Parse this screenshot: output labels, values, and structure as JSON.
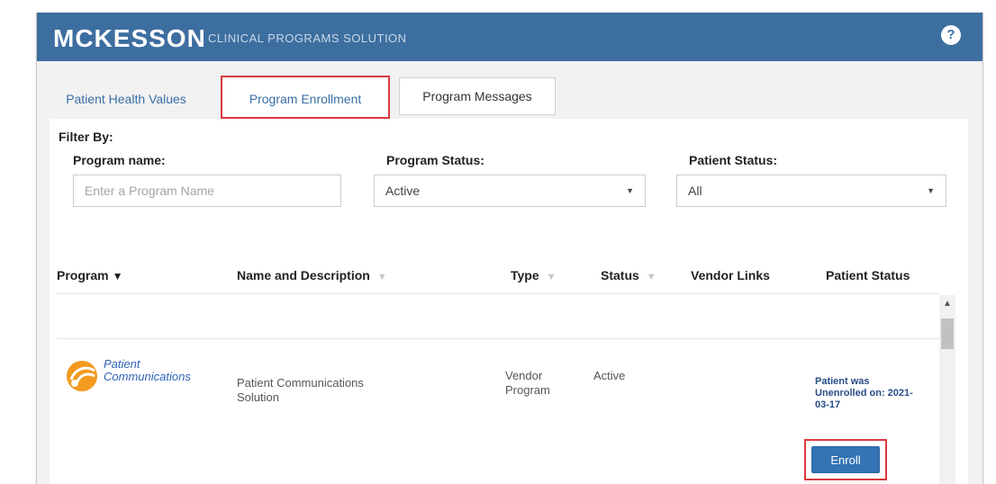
{
  "header": {
    "logo": "MCKESSON",
    "subtitle": "CLINICAL PROGRAMS SOLUTION",
    "help_icon": "?"
  },
  "tabs": [
    {
      "label": "Patient Health Values"
    },
    {
      "label": "Program Enrollment"
    },
    {
      "label": "Program Messages"
    }
  ],
  "filters": {
    "title": "Filter By:",
    "program_name_label": "Program name:",
    "program_name_placeholder": "Enter a Program Name",
    "program_status_label": "Program Status:",
    "program_status_value": "Active",
    "patient_status_label": "Patient Status:",
    "patient_status_value": "All"
  },
  "table": {
    "columns": [
      "Program",
      "Name and Description",
      "Type",
      "Status",
      "Vendor Links",
      "Patient Status"
    ],
    "rows": [
      {
        "logo_text_line1": "Patient",
        "logo_text_line2": "Communications",
        "name_line1": "Patient Communications",
        "name_line2": "Solution",
        "type_line1": "Vendor",
        "type_line2": "Program",
        "status": "Active",
        "vendor_links": "",
        "patient_status": "Patient was Unenrolled on: 2021-03-17",
        "action": "Enroll"
      }
    ]
  },
  "colors": {
    "header": "#3d6ea0",
    "link": "#3a6ea5",
    "highlight": "#d9393e",
    "button": "#3473b4"
  }
}
